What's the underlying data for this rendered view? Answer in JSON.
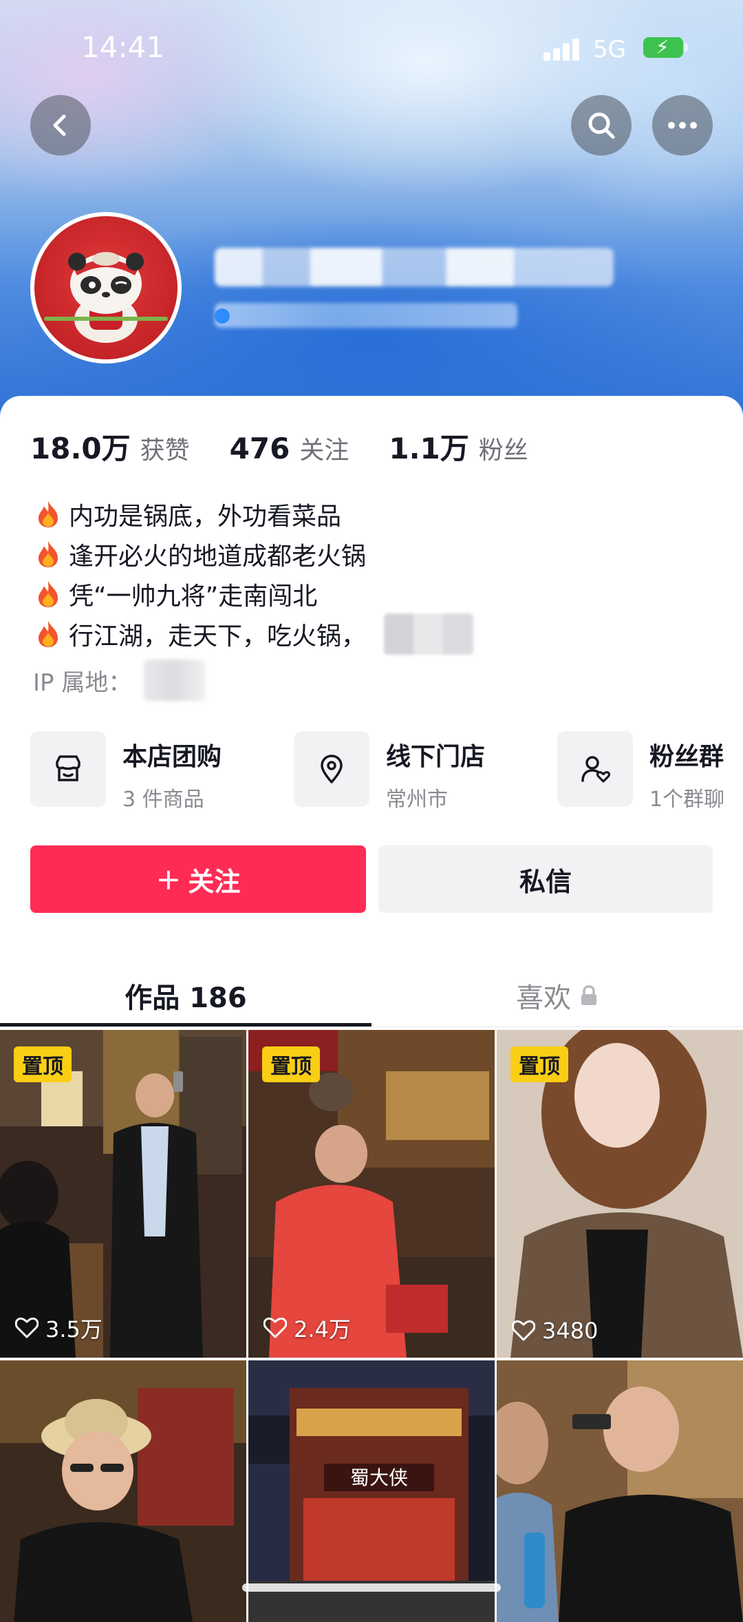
{
  "status_bar": {
    "time": "14:41",
    "network": "5G"
  },
  "profile": {
    "stats": [
      {
        "value": "18.0万",
        "label": "获赞"
      },
      {
        "value": "476",
        "label": "关注"
      },
      {
        "value": "1.1万",
        "label": "粉丝"
      }
    ],
    "bio": [
      "内功是锅底，外功看菜品",
      "逢开必火的地道成都老火锅",
      "凭“一帅九将”走南闯北",
      "行江湖，走天下，吃火锅，"
    ],
    "ip_label": "IP 属地："
  },
  "entries": [
    {
      "title": "本店团购",
      "sub": "3 件商品",
      "icon": "shop-icon"
    },
    {
      "title": "线下门店",
      "sub": "常州市",
      "icon": "location-pin-icon"
    },
    {
      "title": "粉丝群",
      "sub": "1个群聊",
      "icon": "fan-group-icon"
    }
  ],
  "actions": {
    "follow": "关注",
    "follow_icon": "+",
    "message": "私信"
  },
  "tabs": {
    "works": "作品 186",
    "likes": "喜欢"
  },
  "videos": [
    {
      "pinned_label": "置顶",
      "likes": "3.5万"
    },
    {
      "pinned_label": "置顶",
      "likes": "2.4万"
    },
    {
      "pinned_label": "置顶",
      "likes": "3480"
    }
  ],
  "colors": {
    "accent": "#fe2c55",
    "pin": "#face15",
    "header_blue": "#2a6fd4"
  }
}
